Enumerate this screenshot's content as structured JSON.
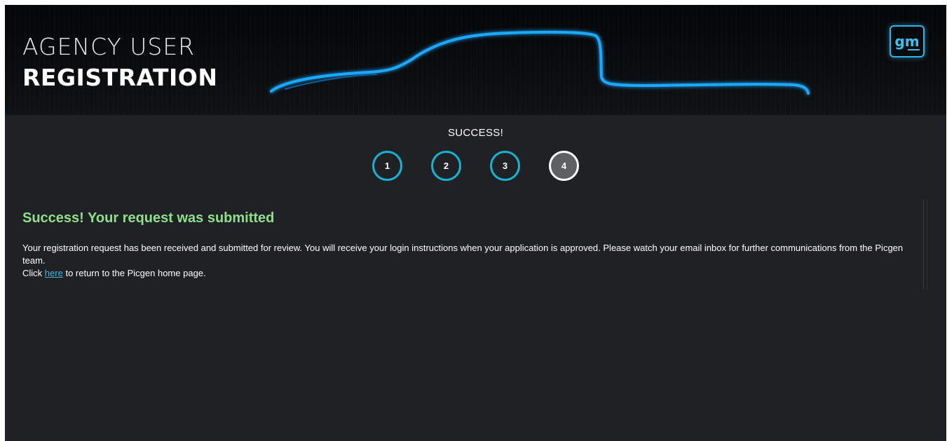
{
  "banner": {
    "title_line1": "AGENCY USER",
    "title_line2": "REGISTRATION",
    "logo_text": "gm",
    "accent_color": "#2fb3e8"
  },
  "progress": {
    "label": "SUCCESS!",
    "steps": [
      "1",
      "2",
      "3",
      "4"
    ],
    "current_step": 4,
    "step_color": "#15b3d4"
  },
  "message": {
    "heading": "Success! Your request was submitted",
    "heading_color": "#8ee08a",
    "paragraph": "Your registration request has been received and submitted for review. You will receive your login instructions when your application is approved. Please watch your email inbox for further communications from the Picgen team.",
    "click_prefix": "Click",
    "link_text": "here",
    "click_suffix": "to return to the Picgen home page."
  },
  "icons": {
    "logo": "gm-logo-icon",
    "car": "car-outline-icon"
  }
}
